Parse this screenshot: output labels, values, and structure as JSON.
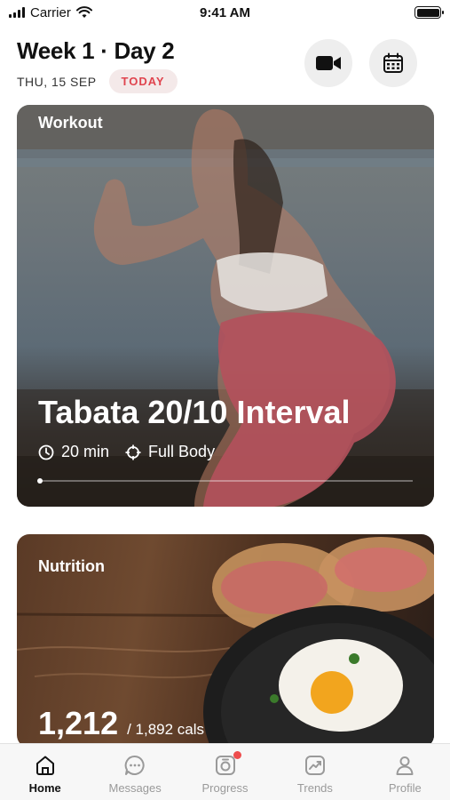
{
  "status_bar": {
    "carrier": "Carrier",
    "time": "9:41 AM"
  },
  "header": {
    "week_title": "Week 1 · Day 2",
    "date": "THU, 15 SEP",
    "today_badge": "TODAY",
    "video_icon": "video-camera-icon",
    "calendar_icon": "calendar-icon"
  },
  "workout_card": {
    "label": "Workout",
    "title": "Tabata 20/10 Interval",
    "duration": "20 min",
    "focus": "Full Body",
    "duration_icon": "clock-icon",
    "focus_icon": "crosshair-icon"
  },
  "nutrition_card": {
    "label": "Nutrition",
    "calories": "1,212",
    "calories_total": "/ 1,892 cals"
  },
  "tabs": [
    {
      "label": "Home",
      "icon": "home-icon",
      "active": true
    },
    {
      "label": "Messages",
      "icon": "chat-icon",
      "active": false
    },
    {
      "label": "Progress",
      "icon": "camera-progress-icon",
      "active": false,
      "badge": true
    },
    {
      "label": "Trends",
      "icon": "trend-chart-icon",
      "active": false
    },
    {
      "label": "Profile",
      "icon": "person-icon",
      "active": false
    }
  ],
  "colors": {
    "accent_red": "#e0444e",
    "badge_bg": "#f4e9e9",
    "tab_inactive": "#9a9a9a"
  }
}
